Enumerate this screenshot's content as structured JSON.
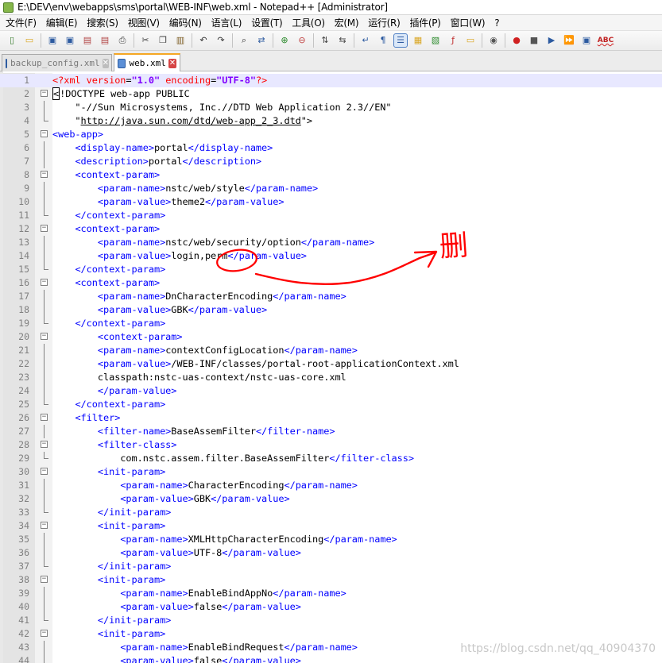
{
  "window": {
    "title": "E:\\DEV\\env\\webapps\\sms\\portal\\WEB-INF\\web.xml - Notepad++ [Administrator]"
  },
  "menu": [
    "文件(F)",
    "编辑(E)",
    "搜索(S)",
    "视图(V)",
    "编码(N)",
    "语言(L)",
    "设置(T)",
    "工具(O)",
    "宏(M)",
    "运行(R)",
    "插件(P)",
    "窗口(W)",
    "?"
  ],
  "toolbar": {
    "icons": [
      "new-file-icon",
      "open-file-icon",
      "save-icon",
      "save-all-icon",
      "close-icon",
      "close-all-icon",
      "print-icon",
      "cut-icon",
      "copy-icon",
      "paste-icon",
      "undo-icon",
      "redo-icon",
      "find-icon",
      "replace-icon",
      "zoom-in-icon",
      "zoom-out-icon",
      "sync-vertical-icon",
      "sync-horizontal-icon",
      "word-wrap-icon",
      "show-all-chars-icon",
      "indent-guide-icon",
      "user-language-icon",
      "doc-map-icon",
      "function-list-icon",
      "folder-workspace-icon",
      "monitoring-icon",
      "record-macro-icon",
      "stop-macro-icon",
      "play-macro-icon",
      "run-macro-multiple-icon",
      "save-macro-icon",
      "spell-check-icon"
    ],
    "spell_check_label": "ABC"
  },
  "tabs": [
    {
      "label": "backup_config.xml",
      "active": false,
      "close": "✕"
    },
    {
      "label": "web.xml",
      "active": true,
      "close": "✕"
    }
  ],
  "colors": {
    "tag": "#0000ff",
    "processing_instruction": "#ff0000",
    "attribute": "#ff0000",
    "attribute_value": "#8000ff",
    "current_line": "#e8e8ff",
    "annotation": "#ff0000"
  },
  "editor": {
    "current_line": 1,
    "lines": [
      {
        "n": "1",
        "fold": "",
        "code": "<?xml version=\"1.0\" encoding=\"UTF-8\"?>"
      },
      {
        "n": "2",
        "fold": "open",
        "code": "<!DOCTYPE web-app PUBLIC"
      },
      {
        "n": "3",
        "fold": "line",
        "code": "    \"-//Sun Microsystems, Inc.//DTD Web Application 2.3//EN\""
      },
      {
        "n": "4",
        "fold": "end",
        "code": "    \"http://java.sun.com/dtd/web-app_2_3.dtd\">"
      },
      {
        "n": "5",
        "fold": "open",
        "code": "<web-app>"
      },
      {
        "n": "6",
        "fold": "line",
        "code": "    <display-name>portal</display-name>"
      },
      {
        "n": "7",
        "fold": "line",
        "code": "    <description>portal</description>"
      },
      {
        "n": "8",
        "fold": "open",
        "code": "    <context-param>"
      },
      {
        "n": "9",
        "fold": "line",
        "code": "        <param-name>nstc/web/style</param-name>"
      },
      {
        "n": "10",
        "fold": "line",
        "code": "        <param-value>theme2</param-value>"
      },
      {
        "n": "11",
        "fold": "end",
        "code": "    </context-param>"
      },
      {
        "n": "12",
        "fold": "open",
        "code": "    <context-param>"
      },
      {
        "n": "13",
        "fold": "line",
        "code": "        <param-name>nstc/web/security/option</param-name>"
      },
      {
        "n": "14",
        "fold": "line",
        "code": "        <param-value>login,perm</param-value>"
      },
      {
        "n": "15",
        "fold": "end",
        "code": "    </context-param>"
      },
      {
        "n": "16",
        "fold": "open",
        "code": "    <context-param>"
      },
      {
        "n": "17",
        "fold": "line",
        "code": "        <param-name>DnCharacterEncoding</param-name>"
      },
      {
        "n": "18",
        "fold": "line",
        "code": "        <param-value>GBK</param-value>"
      },
      {
        "n": "19",
        "fold": "end",
        "code": "    </context-param>"
      },
      {
        "n": "20",
        "fold": "open",
        "code": "        <context-param>"
      },
      {
        "n": "21",
        "fold": "line",
        "code": "        <param-name>contextConfigLocation</param-name>"
      },
      {
        "n": "22",
        "fold": "line",
        "code": "        <param-value>/WEB-INF/classes/portal-root-applicationContext.xml"
      },
      {
        "n": "23",
        "fold": "line",
        "code": "        classpath:nstc-uas-context/nstc-uas-core.xml"
      },
      {
        "n": "24",
        "fold": "line",
        "code": "        </param-value>"
      },
      {
        "n": "25",
        "fold": "end",
        "code": "    </context-param>"
      },
      {
        "n": "26",
        "fold": "open",
        "code": "    <filter>"
      },
      {
        "n": "27",
        "fold": "line",
        "code": "        <filter-name>BaseAssemFilter</filter-name>"
      },
      {
        "n": "28",
        "fold": "open",
        "code": "        <filter-class>"
      },
      {
        "n": "29",
        "fold": "end",
        "code": "            com.nstc.assem.filter.BaseAssemFilter</filter-class>"
      },
      {
        "n": "30",
        "fold": "open",
        "code": "        <init-param>"
      },
      {
        "n": "31",
        "fold": "line",
        "code": "            <param-name>CharacterEncoding</param-name>"
      },
      {
        "n": "32",
        "fold": "line",
        "code": "            <param-value>GBK</param-value>"
      },
      {
        "n": "33",
        "fold": "end",
        "code": "        </init-param>"
      },
      {
        "n": "34",
        "fold": "open",
        "code": "        <init-param>"
      },
      {
        "n": "35",
        "fold": "line",
        "code": "            <param-name>XMLHttpCharacterEncoding</param-name>"
      },
      {
        "n": "36",
        "fold": "line",
        "code": "            <param-value>UTF-8</param-value>"
      },
      {
        "n": "37",
        "fold": "end",
        "code": "        </init-param>"
      },
      {
        "n": "38",
        "fold": "open",
        "code": "        <init-param>"
      },
      {
        "n": "39",
        "fold": "line",
        "code": "            <param-name>EnableBindAppNo</param-name>"
      },
      {
        "n": "40",
        "fold": "line",
        "code": "            <param-value>false</param-value>"
      },
      {
        "n": "41",
        "fold": "end",
        "code": "        </init-param>"
      },
      {
        "n": "42",
        "fold": "open",
        "code": "        <init-param>"
      },
      {
        "n": "43",
        "fold": "line",
        "code": "            <param-name>EnableBindRequest</param-name>"
      },
      {
        "n": "44",
        "fold": "line",
        "code": "            <param-value>false</param-value>"
      }
    ]
  },
  "annotation": {
    "text": "删"
  },
  "watermark": "https://blog.csdn.net/qq_40904370"
}
